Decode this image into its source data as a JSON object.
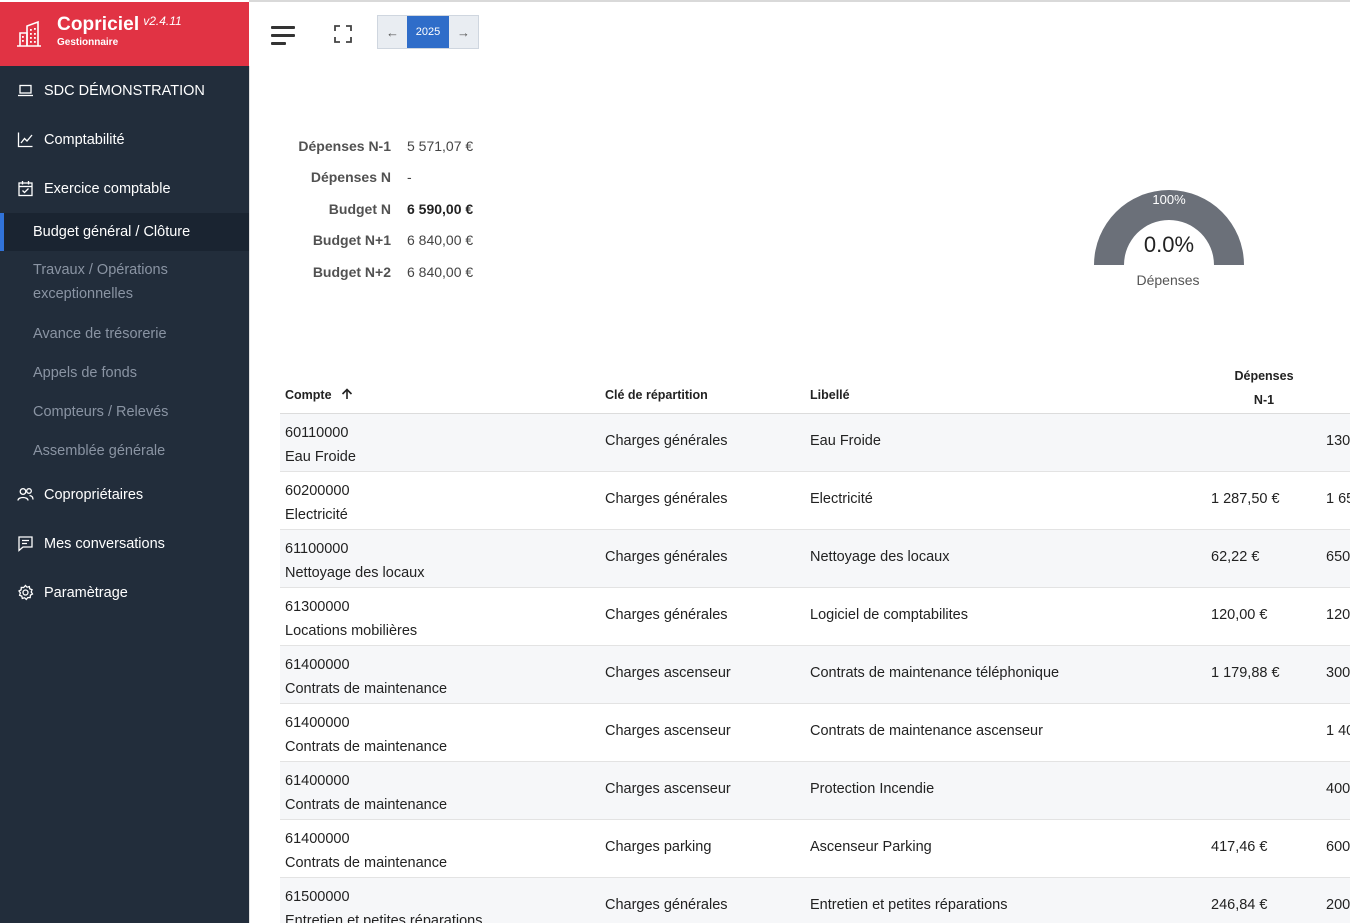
{
  "brand": {
    "name": "Copriciel",
    "version": "v2.4.11",
    "role": "Gestionnaire",
    "color": "#e13344"
  },
  "sidebar": {
    "items": [
      {
        "label": "SDC DÉMONSTRATION",
        "icon": "laptop-icon"
      },
      {
        "label": "Comptabilité",
        "icon": "chart-line-icon"
      },
      {
        "label": "Exercice comptable",
        "icon": "calendar-check-icon"
      }
    ],
    "subitems": [
      {
        "label": "Budget général / Clôture",
        "active": true
      },
      {
        "label": "Travaux / Opérations exceptionnelles"
      },
      {
        "label": "Avance de trésorerie"
      },
      {
        "label": "Appels de fonds"
      },
      {
        "label": "Compteurs / Relevés"
      },
      {
        "label": "Assemblée générale"
      }
    ],
    "items_after": [
      {
        "label": "Copropriétaires",
        "icon": "users-icon"
      },
      {
        "label": "Mes conversations",
        "icon": "chat-icon"
      },
      {
        "label": "Paramètrage",
        "icon": "gear-icon"
      }
    ]
  },
  "topbar": {
    "prev_label": "←",
    "year": "2025",
    "next_label": "→"
  },
  "summary": [
    {
      "label": "Dépenses N-1",
      "value": "5 571,07 €",
      "bold": false
    },
    {
      "label": "Dépenses N",
      "value": "-",
      "bold": false
    },
    {
      "label": "Budget N",
      "value": "6 590,00 €",
      "bold": true
    },
    {
      "label": "Budget N+1",
      "value": "6 840,00 €",
      "bold": false
    },
    {
      "label": "Budget N+2",
      "value": "6 840,00 €",
      "bold": false
    }
  ],
  "gauge": {
    "max_label": "100%",
    "value_label": "0.0%",
    "value": 0.0,
    "caption": "Dépenses",
    "color": "#6b7079"
  },
  "table": {
    "headers": {
      "compte": "Compte",
      "cle": "Clé de répartition",
      "libelle": "Libellé",
      "depenses_line1": "Dépenses",
      "depenses_line2": "N-1"
    },
    "rows": [
      {
        "compte": "60110000",
        "compte_label": "Eau Froide",
        "cle": "Charges générales",
        "libelle": "Eau Froide",
        "depenses_n1": "",
        "budget": "130"
      },
      {
        "compte": "60200000",
        "compte_label": "Electricité",
        "cle": "Charges générales",
        "libelle": "Electricité",
        "depenses_n1": "1 287,50 €",
        "budget": "1 65"
      },
      {
        "compte": "61100000",
        "compte_label": "Nettoyage des locaux",
        "cle": "Charges générales",
        "libelle": "Nettoyage des locaux",
        "depenses_n1": "62,22 €",
        "budget": "650"
      },
      {
        "compte": "61300000",
        "compte_label": "Locations mobilières",
        "cle": "Charges générales",
        "libelle": "Logiciel de comptabilites",
        "depenses_n1": "120,00 €",
        "budget": "120"
      },
      {
        "compte": "61400000",
        "compte_label": "Contrats de maintenance",
        "cle": "Charges ascenseur",
        "libelle": "Contrats de maintenance téléphonique",
        "depenses_n1": "1 179,88 €",
        "budget": "300"
      },
      {
        "compte": "61400000",
        "compte_label": "Contrats de maintenance",
        "cle": "Charges ascenseur",
        "libelle": "Contrats de maintenance ascenseur",
        "depenses_n1": "",
        "budget": "1 40"
      },
      {
        "compte": "61400000",
        "compte_label": "Contrats de maintenance",
        "cle": "Charges ascenseur",
        "libelle": "Protection Incendie",
        "depenses_n1": "",
        "budget": "400"
      },
      {
        "compte": "61400000",
        "compte_label": "Contrats de maintenance",
        "cle": "Charges parking",
        "libelle": "Ascenseur Parking",
        "depenses_n1": "417,46 €",
        "budget": "600"
      },
      {
        "compte": "61500000",
        "compte_label": "Entretien et petites réparations",
        "cle": "Charges générales",
        "libelle": "Entretien et petites réparations",
        "depenses_n1": "246,84 €",
        "budget": "200"
      }
    ]
  }
}
